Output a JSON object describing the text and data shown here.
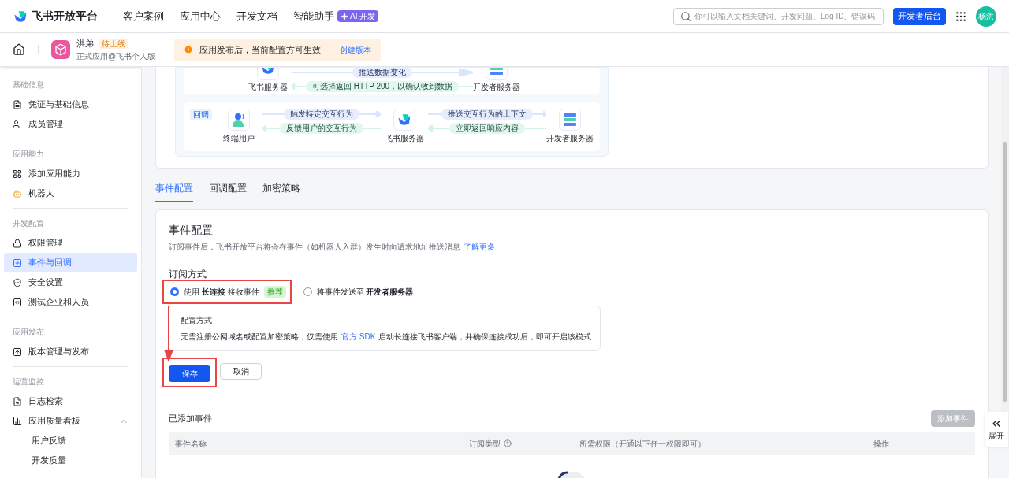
{
  "header": {
    "logo_text": "飞书开放平台",
    "nav": [
      {
        "label": "客户案例"
      },
      {
        "label": "应用中心"
      },
      {
        "label": "开发文档"
      },
      {
        "label": "智能助手"
      }
    ],
    "ai_badge": "AI 开发",
    "search": {
      "placeholder": "你可以输入文档关键词、开发问题、Log ID、错误码"
    },
    "console_button": "开发者后台",
    "avatar_text": "杨洪"
  },
  "app_bar": {
    "name": "洪弟",
    "status": "待上线",
    "subtitle": "正式应用@飞书个人版",
    "notice": "应用发布后，当前配置方可生效",
    "notice_link": "创建版本"
  },
  "sidebar": [
    {
      "title": "基础信息",
      "items": [
        {
          "label": "凭证与基础信息",
          "selected": false
        },
        {
          "label": "成员管理",
          "selected": false
        }
      ]
    },
    {
      "title": "应用能力",
      "items": [
        {
          "label": "添加应用能力",
          "selected": false
        },
        {
          "label": "机器人",
          "selected": false
        }
      ]
    },
    {
      "title": "开发配置",
      "items": [
        {
          "label": "权限管理",
          "selected": false
        },
        {
          "label": "事件与回调",
          "selected": true
        },
        {
          "label": "安全设置",
          "selected": false
        },
        {
          "label": "测试企业和人员",
          "selected": false
        }
      ]
    },
    {
      "title": "应用发布",
      "items": [
        {
          "label": "版本管理与发布",
          "selected": false
        }
      ]
    },
    {
      "title": "运营监控",
      "items": [
        {
          "label": "日志检索",
          "selected": false
        },
        {
          "label": "应用质量看板",
          "selected": false,
          "expanded": true,
          "children": [
            {
              "label": "用户反馈",
              "selected": false
            },
            {
              "label": "开发质量",
              "selected": false
            }
          ]
        }
      ]
    }
  ],
  "diagram": [
    {
      "nodes": [
        {
          "label": "飞书服务器",
          "kind": "feishu"
        },
        {
          "label": "开发者服务器",
          "kind": "server"
        }
      ],
      "links": [
        {
          "forward": "推送数据变化",
          "back": "可选择返回 HTTP 200，以确认收到数据"
        }
      ]
    },
    {
      "tag": "回调",
      "nodes": [
        {
          "label": "终端用户",
          "kind": "user"
        },
        {
          "label": "飞书服务器",
          "kind": "feishu"
        },
        {
          "label": "开发者服务器",
          "kind": "server"
        }
      ],
      "links": [
        {
          "forward": "触发特定交互行为",
          "back": "反馈用户的交互行为"
        },
        {
          "forward": "推送交互行为的上下文",
          "back": "立即返回响应内容"
        }
      ]
    }
  ],
  "tabs": [
    {
      "label": "事件配置",
      "selected": true
    },
    {
      "label": "回调配置",
      "selected": false
    },
    {
      "label": "加密策略",
      "selected": false
    }
  ],
  "event_config": {
    "title": "事件配置",
    "description": "订阅事件后，飞书开放平台将会在事件（如机器人入群）发生时向请求地址推送消息",
    "description_link": "了解更多",
    "subscription_title": "订阅方式",
    "options": [
      {
        "label": "使用 **长连接** 接收事件",
        "badge": "推荐",
        "selected": true
      },
      {
        "label": "将事件发送至 **开发者服务器**",
        "selected": false
      }
    ],
    "method": {
      "title": "配置方式",
      "text_before": "无需注册公网域名或配置加密策略，仅需使用",
      "link": "官方 SDK",
      "text_after": "启动长连接飞书客户端，并确保连接成功后，即可开启该模式"
    },
    "buttons": [
      {
        "label": "保存",
        "kind": "primary"
      },
      {
        "label": "取消",
        "kind": "default"
      }
    ]
  },
  "added_events": {
    "title": "已添加事件",
    "add_button": {
      "label": "添加事件",
      "disabled": true
    },
    "columns": [
      {
        "label": "事件名称",
        "help": false
      },
      {
        "label": "订阅类型",
        "help": true
      },
      {
        "label": "所需权限（开通以下任一权限即可）",
        "help": false
      },
      {
        "label": "操作",
        "help": false
      }
    ]
  },
  "side_toggle": {
    "label": "展开"
  }
}
